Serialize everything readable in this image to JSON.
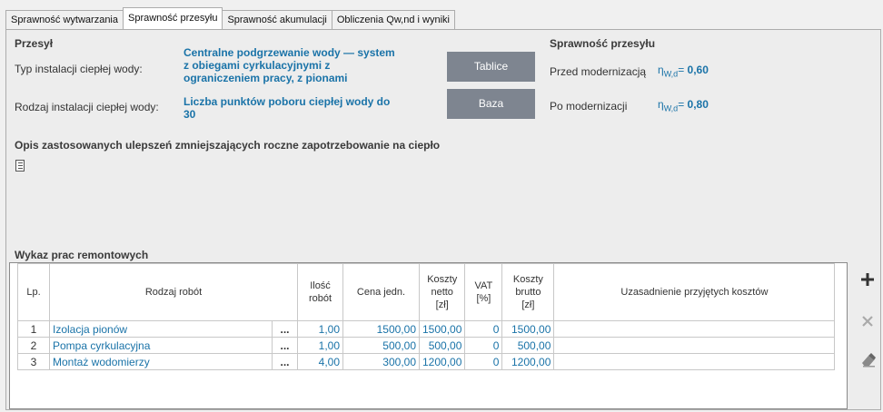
{
  "tabs": [
    "Sprawność wytwarzania",
    "Sprawność przesyłu",
    "Sprawność akumulacji",
    "Obliczenia Qw,nd i wyniki"
  ],
  "przesyl": {
    "heading": "Przesył",
    "typ_label": "Typ instalacji ciepłej wody:",
    "typ_value_lines": [
      "Centralne podgrzewanie wody — system",
      "z obiegami cyrkulacyjnymi z",
      "ograniczeniem pracy, z pionami"
    ],
    "rodzaj_label": "Rodzaj instalacji ciepłej wody:",
    "rodzaj_value_lines": [
      "Liczba punktów poboru ciepłej wody do",
      "30"
    ],
    "btn_tablice": "Tablice",
    "btn_baza": "Baza"
  },
  "sprawnosc": {
    "heading": "Sprawność przesyłu",
    "przed_label": "Przed modernizacją",
    "po_label": "Po modernizacji",
    "eta_symbol": "η",
    "eta_sub": "W,d",
    "przed_value": "0,60",
    "po_value": "0,80"
  },
  "opis": {
    "heading": "Opis zastosowanych ulepszeń zmniejszających roczne zapotrzebowanie na ciepło"
  },
  "wykaz": {
    "heading": "Wykaz prac remontowych",
    "columns": {
      "lp": "Lp.",
      "rodzaj": "Rodzaj robót",
      "ilosc": [
        "Ilość",
        "robót"
      ],
      "cena": "Cena jedn.",
      "netto": [
        "Koszty",
        "netto",
        "[zł]"
      ],
      "vat": [
        "VAT",
        "[%]"
      ],
      "brutto": [
        "Koszty",
        "brutto",
        "[zł]"
      ],
      "uzasadnienie": "Uzasadnienie przyjętych kosztów"
    },
    "dots": "...",
    "rows": [
      {
        "lp": "1",
        "rodzaj": "Izolacja pionów",
        "ilosc": "1,00",
        "cena": "1500,00",
        "netto": "1500,00",
        "vat": "0",
        "brutto": "1500,00",
        "uzasadnienie": ""
      },
      {
        "lp": "2",
        "rodzaj": "Pompa cyrkulacyjna",
        "ilosc": "1,00",
        "cena": "500,00",
        "netto": "500,00",
        "vat": "0",
        "brutto": "500,00",
        "uzasadnienie": ""
      },
      {
        "lp": "3",
        "rodzaj": "Montaż wodomierzy",
        "ilosc": "4,00",
        "cena": "300,00",
        "netto": "1200,00",
        "vat": "0",
        "brutto": "1200,00",
        "uzasadnienie": ""
      }
    ]
  },
  "side_icons": [
    "plus-icon",
    "close-icon",
    "eraser-icon"
  ],
  "colors": {
    "accent": "#1a73a8",
    "button": "#7e8590"
  }
}
